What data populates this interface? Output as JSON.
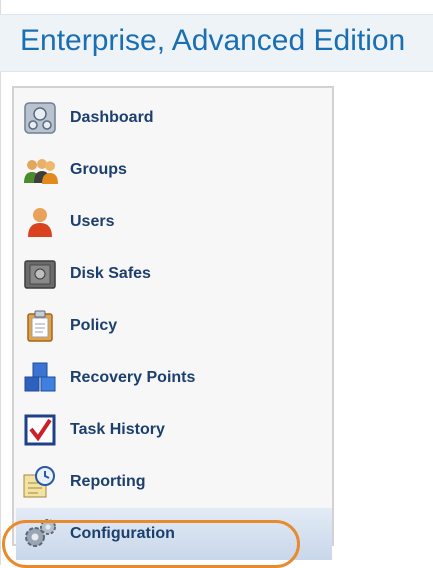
{
  "header": {
    "title": "Enterprise, Advanced Edition"
  },
  "nav": {
    "items": [
      {
        "label": "Dashboard",
        "icon": "dashboard-icon"
      },
      {
        "label": "Groups",
        "icon": "groups-icon"
      },
      {
        "label": "Users",
        "icon": "users-icon"
      },
      {
        "label": "Disk Safes",
        "icon": "disk-safe-icon"
      },
      {
        "label": "Policy",
        "icon": "policy-icon"
      },
      {
        "label": "Recovery Points",
        "icon": "recovery-points-icon"
      },
      {
        "label": "Task History",
        "icon": "task-history-icon"
      },
      {
        "label": "Reporting",
        "icon": "reporting-icon"
      },
      {
        "label": "Configuration",
        "icon": "configuration-icon",
        "active": true
      }
    ]
  },
  "colors": {
    "header_text": "#1a6fb3",
    "nav_text": "#1d3f6e",
    "highlight_ring": "#e88a2e",
    "active_bg": "#c8d7ea"
  }
}
